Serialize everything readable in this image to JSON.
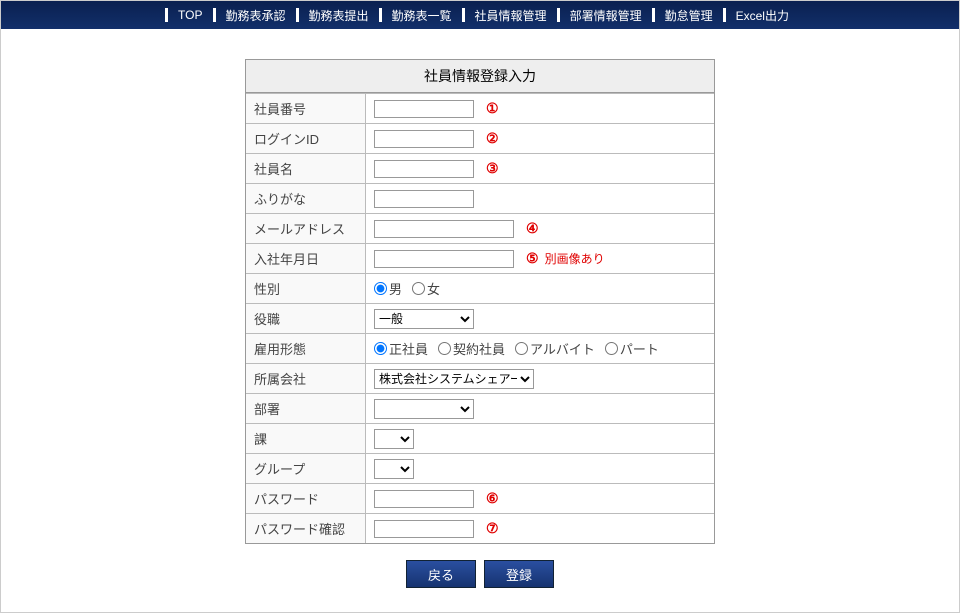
{
  "nav": [
    "TOP",
    "勤務表承認",
    "勤務表提出",
    "勤務表一覧",
    "社員情報管理",
    "部署情報管理",
    "勤怠管理",
    "Excel出力"
  ],
  "form": {
    "title": "社員情報登録入力",
    "labels": {
      "empNo": "社員番号",
      "loginId": "ログインID",
      "empName": "社員名",
      "furigana": "ふりがな",
      "email": "メールアドレス",
      "joinDate": "入社年月日",
      "gender": "性別",
      "position": "役職",
      "empType": "雇用形態",
      "company": "所属会社",
      "dept": "部署",
      "section": "課",
      "group": "グループ",
      "password": "パスワード",
      "passwordConfirm": "パスワード確認"
    },
    "markers": {
      "1": "①",
      "2": "②",
      "3": "③",
      "4": "④",
      "5": "⑤",
      "6": "⑥",
      "7": "⑦"
    },
    "joinDateNote": "別画像あり",
    "gender": {
      "male": "男",
      "female": "女",
      "selected": "male"
    },
    "position": {
      "selected": "一般"
    },
    "empType": {
      "options": [
        "正社員",
        "契約社員",
        "アルバイト",
        "パート"
      ],
      "selected": "正社員"
    },
    "company": {
      "selected": "株式会社システムシェアード"
    }
  },
  "buttons": {
    "back": "戻る",
    "submit": "登録"
  }
}
